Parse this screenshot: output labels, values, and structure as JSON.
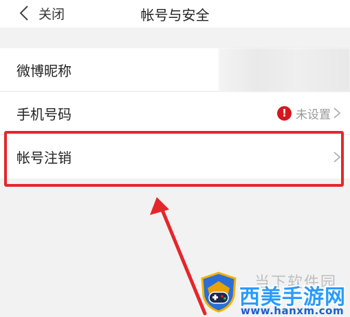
{
  "navbar": {
    "back_label": "关闭",
    "title": "帐号与安全"
  },
  "rows": [
    {
      "label": "微博昵称",
      "value": "",
      "value_obscured": true
    },
    {
      "label": "手机号码",
      "status": "未设置",
      "status_icon": "alert-icon",
      "status_color": "#d31920"
    },
    {
      "label": "帐号注销"
    }
  ],
  "highlight_color": "#e5262b",
  "watermark": {
    "gray_text": "当下软件园",
    "brand": "西美手游网",
    "url": "www.hanxm.com",
    "brand_color": "#2a9bff",
    "url_color": "#1a5fd1"
  }
}
